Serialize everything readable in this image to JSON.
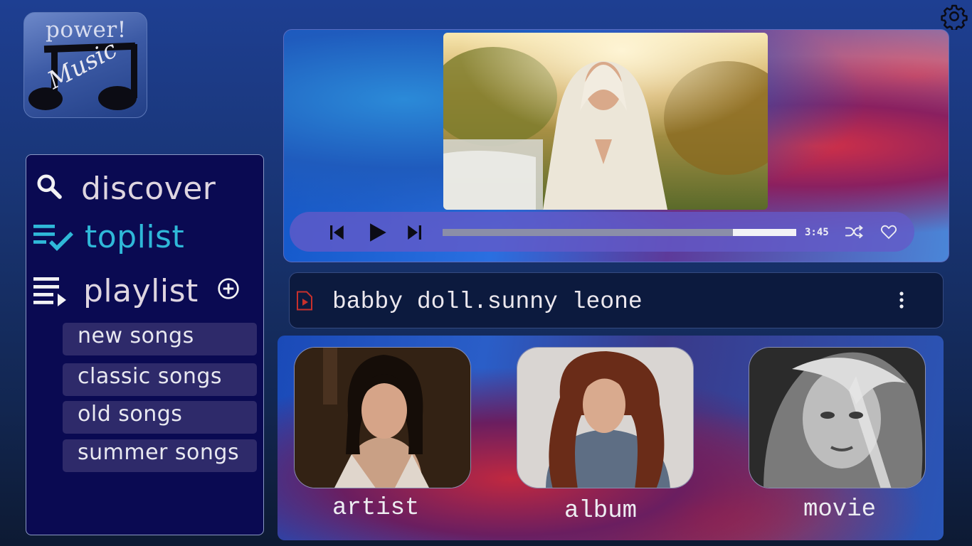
{
  "logo": {
    "top_text": "power!",
    "word": "Music"
  },
  "colors": {
    "background": "#1b3a86",
    "sidebar": "#0a0a52",
    "accent_toplist": "#2fb8d8",
    "playlist_item": "#2e2a6a",
    "controls_bar": "#645ac8",
    "now_playing_bg": "#0c1a3e",
    "file_icon": "#c8302c"
  },
  "icons": {
    "settings": "gear-icon",
    "discover": "search-icon",
    "toplist": "queue-check-icon",
    "playlist": "queue-play-icon",
    "add_playlist": "plus-circle-icon",
    "previous": "skip-previous-icon",
    "play": "play-icon",
    "next": "skip-next-icon",
    "shuffle": "shuffle-icon",
    "favorite": "heart-icon",
    "file": "video-file-icon",
    "more": "more-vertical-icon"
  },
  "sidebar": {
    "nav": [
      {
        "label": "discover",
        "active": false
      },
      {
        "label": "toplist",
        "active": true
      },
      {
        "label": "playlist",
        "active": false
      }
    ],
    "playlists": [
      {
        "label": "new songs"
      },
      {
        "label": "classic songs"
      },
      {
        "label": "old songs"
      },
      {
        "label": "summer songs"
      }
    ]
  },
  "player": {
    "time": "3:45",
    "progress": 0.82
  },
  "now_playing": {
    "title": "babby doll.sunny leone"
  },
  "categories": [
    {
      "label": "artist"
    },
    {
      "label": "album"
    },
    {
      "label": "movie"
    }
  ]
}
